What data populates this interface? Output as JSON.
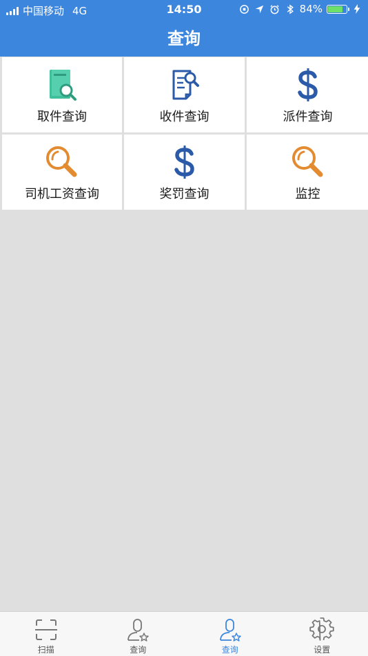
{
  "status_bar": {
    "carrier": "中国移动",
    "network": "4G",
    "time": "14:50",
    "battery": "84%",
    "battery_level": 0.84
  },
  "header": {
    "title": "查询"
  },
  "grid": {
    "items": [
      {
        "label": "取件查询",
        "icon": "book-search-icon"
      },
      {
        "label": "收件查询",
        "icon": "document-search-icon"
      },
      {
        "label": "派件查询",
        "icon": "dollar-icon"
      },
      {
        "label": "司机工资查询",
        "icon": "magnifier-icon"
      },
      {
        "label": "奖罚查询",
        "icon": "dollar-icon"
      },
      {
        "label": "监控",
        "icon": "magnifier-icon"
      }
    ]
  },
  "tabbar": {
    "items": [
      {
        "label": "扫描",
        "icon": "scan-icon"
      },
      {
        "label": "查询",
        "icon": "user-star-icon"
      },
      {
        "label": "查询",
        "icon": "user-star-icon",
        "active": true
      },
      {
        "label": "设置",
        "icon": "gear-icon"
      }
    ]
  },
  "colors": {
    "header_bg": "#3d86de",
    "page_bg": "#dfdfdf",
    "accent_active": "#3d86de",
    "teal_icon": "#3fbf9c",
    "blue_icon": "#2a5aa8",
    "orange_icon": "#e38b30"
  }
}
